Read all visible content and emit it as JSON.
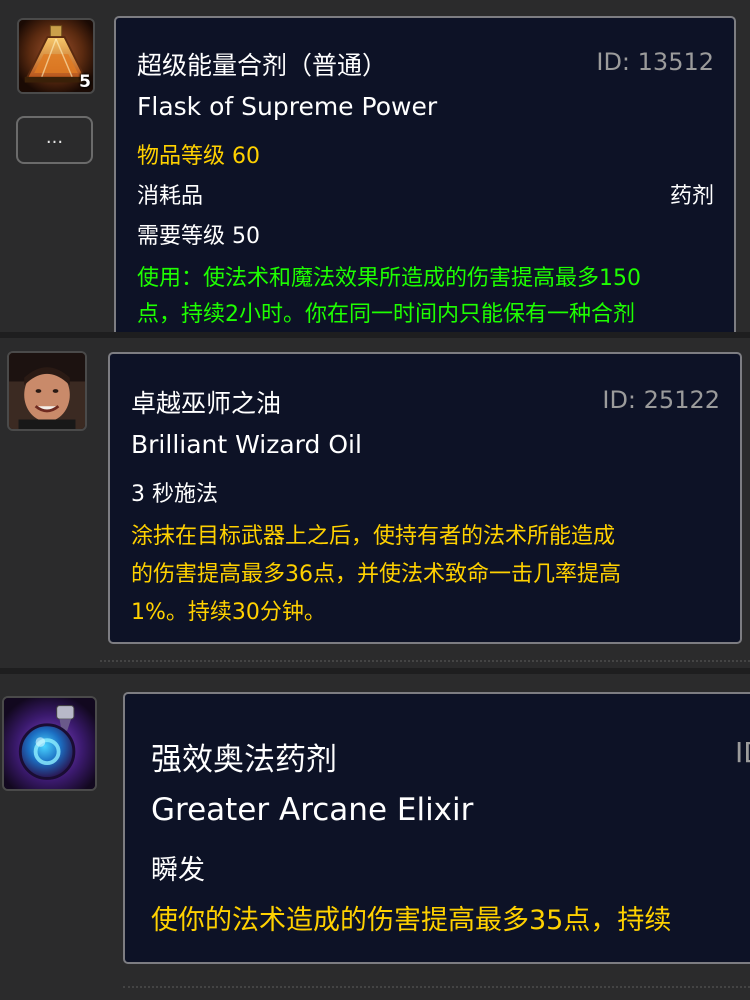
{
  "items": [
    {
      "name_cn": "超级能量合剂（普通）",
      "id_label": "ID: 13512",
      "name_en": "Flask of Supreme Power",
      "item_level": "物品等级 60",
      "type_left": "消耗品",
      "type_right": "药剂",
      "required_level": "需要等级 50",
      "use_text_1": "使用：使法术和魔法效果所造成的伤害提高最多150",
      "use_text_2": "点，持续2小时。你在同一时间内只能保有一种合剂",
      "stack_count": "5",
      "icon": "flask-icon",
      "more_label": "..."
    },
    {
      "name_cn": "卓越巫师之油",
      "id_label": "ID: 25122",
      "name_en": "Brilliant Wizard Oil",
      "cast_time": "3 秒施法",
      "desc_1": "涂抹在目标武器上之后，使持有者的法术所能造成",
      "desc_2": "的伤害提高最多36点，并使法术致命一击几率提高",
      "desc_3": "1%。持续30分钟。",
      "icon": "avatar-portrait-icon"
    },
    {
      "name_cn": "强效奥法药剂",
      "id_label": "ID",
      "name_en": "Greater Arcane Elixir",
      "cast_time": "瞬发",
      "desc_1": "使你的法术造成的伤害提高最多35点，持续",
      "icon": "arcane-elixir-icon"
    }
  ],
  "colors": {
    "background": "#2b2b2c",
    "tooltip_bg": "#0d1226",
    "gold": "#ffd100",
    "green": "#1eff00",
    "gray": "#9b9b9b"
  }
}
